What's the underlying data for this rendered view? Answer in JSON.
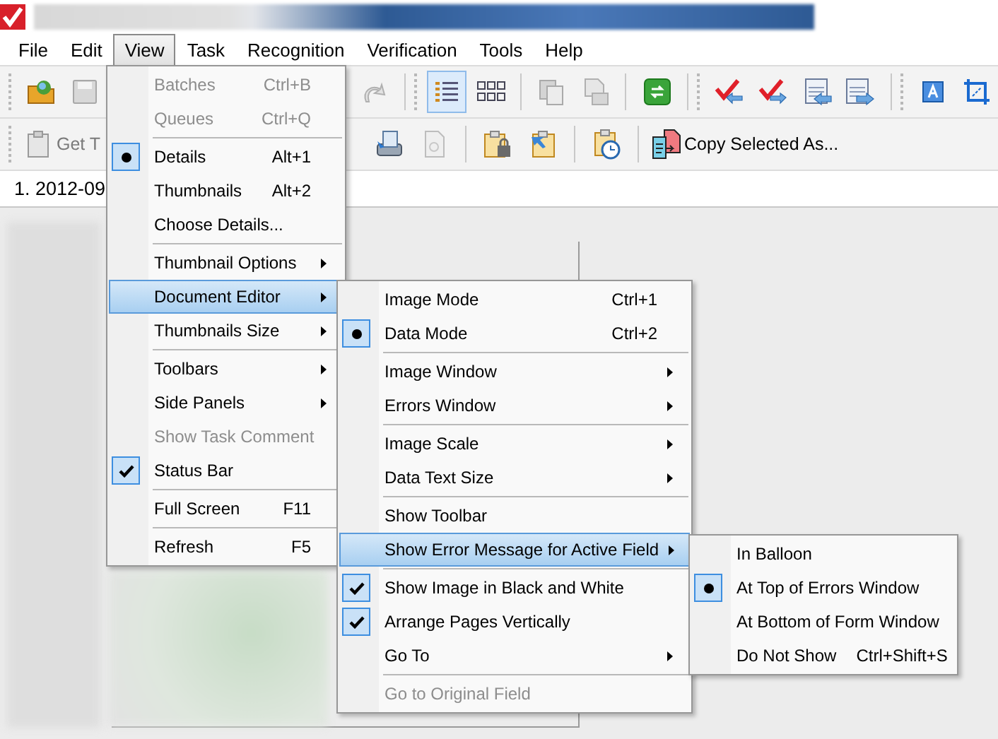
{
  "menu_bar": [
    {
      "label": "File",
      "selected": false
    },
    {
      "label": "Edit",
      "selected": false
    },
    {
      "label": "View",
      "selected": true
    },
    {
      "label": "Task",
      "selected": false
    },
    {
      "label": "Recognition",
      "selected": false
    },
    {
      "label": "Verification",
      "selected": false
    },
    {
      "label": "Tools",
      "selected": false
    },
    {
      "label": "Help",
      "selected": false
    }
  ],
  "toolbar_2": {
    "get_button": "Get T",
    "copy_button": "Copy Selected As..."
  },
  "document_tab": {
    "label": "1. 2012-09"
  },
  "view_menu": [
    {
      "kind": "command",
      "label": "Batches",
      "shortcut": "Ctrl+B",
      "disabled": true,
      "selected": false
    },
    {
      "kind": "command",
      "label": "Queues",
      "shortcut": "Ctrl+Q",
      "disabled": true,
      "selected": false
    },
    {
      "kind": "separator"
    },
    {
      "kind": "radio",
      "label": "Details",
      "shortcut": "Alt+1",
      "checked": true,
      "disabled": false,
      "selected": false
    },
    {
      "kind": "radio",
      "label": "Thumbnails",
      "shortcut": "Alt+2",
      "checked": false,
      "disabled": false,
      "selected": false
    },
    {
      "kind": "command",
      "label": "Choose Details...",
      "disabled": false,
      "selected": false
    },
    {
      "kind": "separator"
    },
    {
      "kind": "submenu",
      "label": "Thumbnail Options",
      "disabled": false,
      "selected": false
    },
    {
      "kind": "submenu",
      "label": "Document Editor",
      "disabled": false,
      "selected": true
    },
    {
      "kind": "submenu",
      "label": "Thumbnails Size",
      "disabled": false,
      "selected": false
    },
    {
      "kind": "separator"
    },
    {
      "kind": "submenu",
      "label": "Toolbars",
      "disabled": false,
      "selected": false
    },
    {
      "kind": "submenu",
      "label": "Side Panels",
      "disabled": false,
      "selected": false
    },
    {
      "kind": "command",
      "label": "Show Task Comment",
      "disabled": true,
      "selected": false
    },
    {
      "kind": "check",
      "label": "Status Bar",
      "checked": true,
      "disabled": false,
      "selected": false
    },
    {
      "kind": "separator"
    },
    {
      "kind": "command",
      "label": "Full Screen",
      "shortcut": "F11",
      "disabled": false,
      "selected": false
    },
    {
      "kind": "separator"
    },
    {
      "kind": "command",
      "label": "Refresh",
      "shortcut": "F5",
      "disabled": false,
      "selected": false
    }
  ],
  "document_editor_menu": [
    {
      "kind": "radio",
      "label": "Image Mode",
      "shortcut": "Ctrl+1",
      "checked": false,
      "disabled": false,
      "selected": false
    },
    {
      "kind": "radio",
      "label": "Data Mode",
      "shortcut": "Ctrl+2",
      "checked": true,
      "disabled": false,
      "selected": false
    },
    {
      "kind": "separator"
    },
    {
      "kind": "submenu",
      "label": "Image Window",
      "disabled": false,
      "selected": false
    },
    {
      "kind": "submenu",
      "label": "Errors Window",
      "disabled": false,
      "selected": false
    },
    {
      "kind": "separator"
    },
    {
      "kind": "submenu",
      "label": "Image Scale",
      "disabled": false,
      "selected": false
    },
    {
      "kind": "submenu",
      "label": "Data Text Size",
      "disabled": false,
      "selected": false
    },
    {
      "kind": "separator"
    },
    {
      "kind": "command",
      "label": "Show Toolbar",
      "disabled": false,
      "selected": false
    },
    {
      "kind": "submenu",
      "label": "Show Error Message for Active Field",
      "disabled": false,
      "selected": true
    },
    {
      "kind": "separator"
    },
    {
      "kind": "check",
      "label": "Show Image in Black and White",
      "checked": true,
      "disabled": false,
      "selected": false
    },
    {
      "kind": "check",
      "label": "Arrange Pages Vertically",
      "checked": true,
      "disabled": false,
      "selected": false
    },
    {
      "kind": "submenu",
      "label": "Go To",
      "disabled": false,
      "selected": false
    },
    {
      "kind": "separator"
    },
    {
      "kind": "command",
      "label": "Go to Original Field",
      "disabled": true,
      "selected": false
    }
  ],
  "error_message_menu": [
    {
      "kind": "radio",
      "label": "In Balloon",
      "checked": false,
      "disabled": false,
      "selected": false
    },
    {
      "kind": "radio",
      "label": "At Top of Errors Window",
      "checked": true,
      "disabled": false,
      "selected": false
    },
    {
      "kind": "radio",
      "label": "At Bottom of Form Window",
      "checked": false,
      "disabled": false,
      "selected": false
    },
    {
      "kind": "radio",
      "label": "Do Not Show",
      "shortcut": "Ctrl+Shift+S",
      "checked": false,
      "disabled": false,
      "selected": false
    }
  ]
}
